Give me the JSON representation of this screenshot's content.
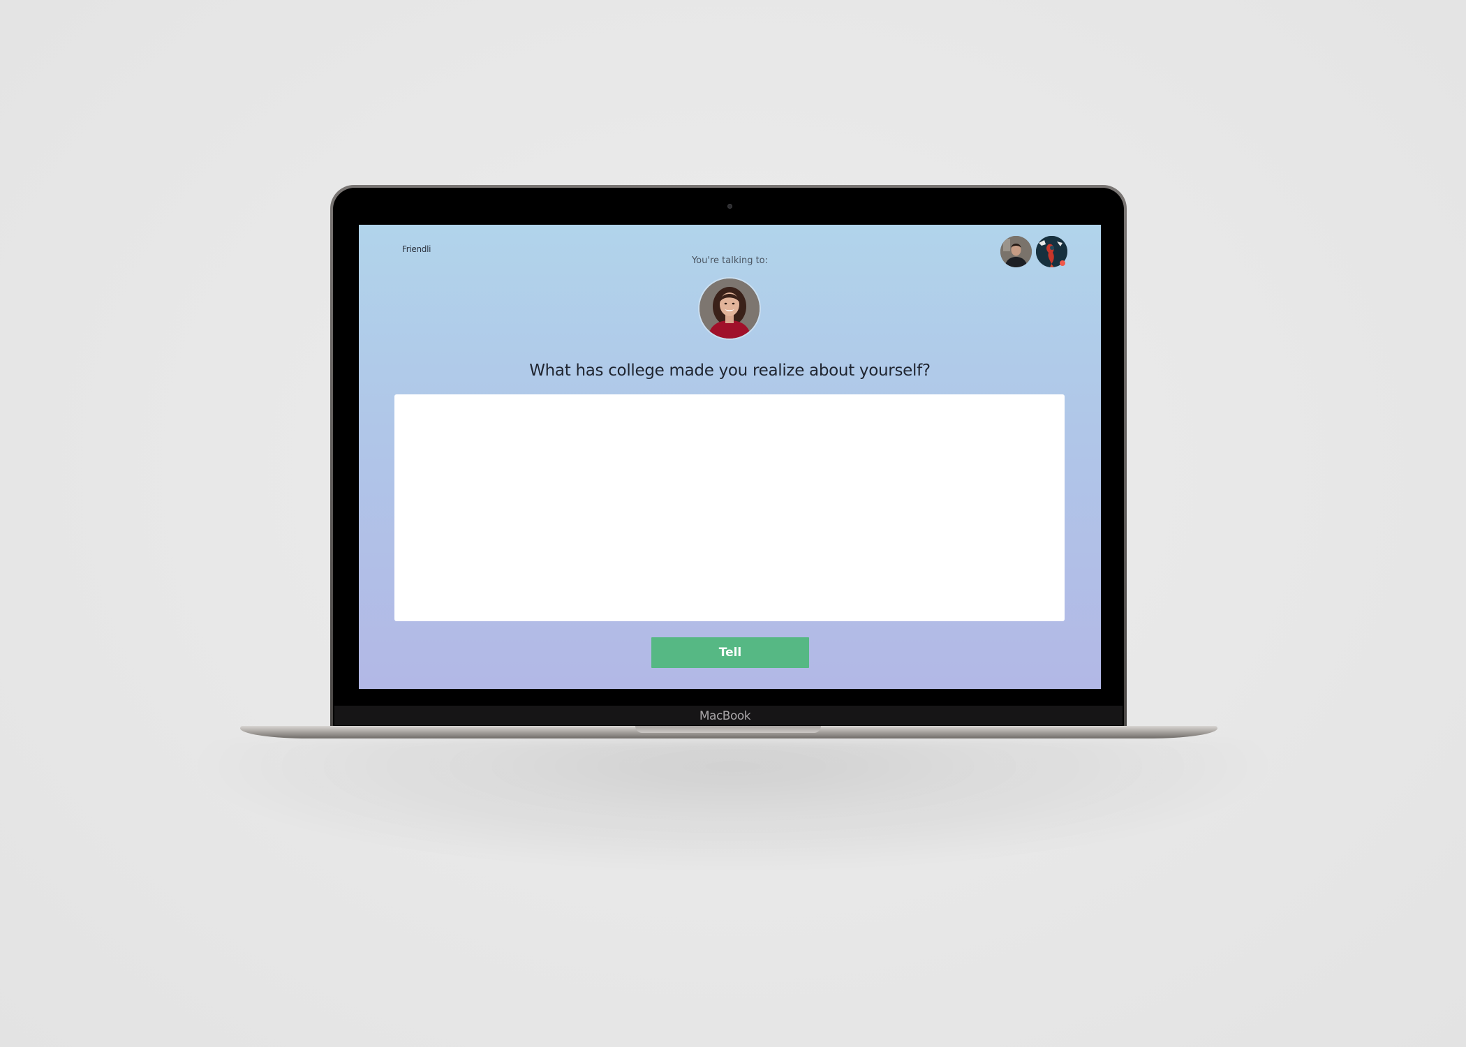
{
  "app": {
    "logo_text": "Friendli"
  },
  "conversation": {
    "talking_to_label": "You're talking to:",
    "question": "What has college made you realize about yourself?"
  },
  "answer": {
    "value": "",
    "placeholder": ""
  },
  "actions": {
    "submit_label": "Tell"
  },
  "device": {
    "brand_label": "MacBook"
  },
  "colors": {
    "button": "#56b884",
    "notification": "#f05a4c",
    "gradient_top": "#b1d4eb",
    "gradient_bottom": "#b2b8e6"
  },
  "icons": {
    "partner_avatar": "avatar-photo-woman",
    "user_avatar": "avatar-photo-man",
    "other_avatar": "avatar-illustration",
    "notification": "red-dot"
  }
}
